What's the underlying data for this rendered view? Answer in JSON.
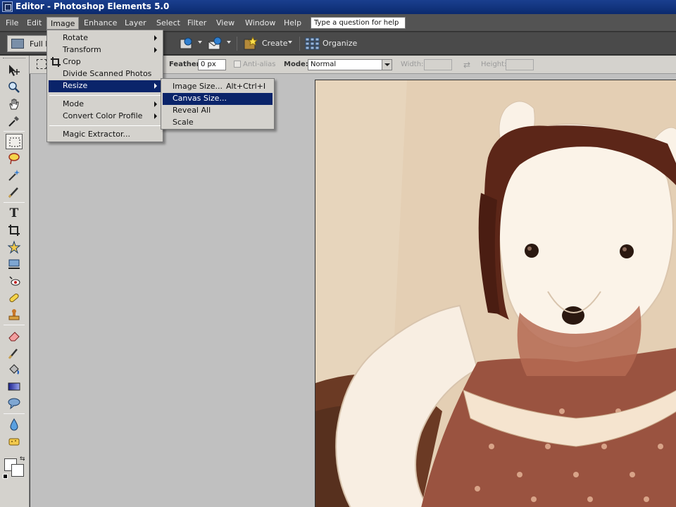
{
  "window": {
    "title": "Editor - Photoshop Elements 5.0"
  },
  "menubar": {
    "items": [
      "File",
      "Edit",
      "Image",
      "Enhance",
      "Layer",
      "Select",
      "Filter",
      "View",
      "Window",
      "Help"
    ],
    "active": "Image",
    "help_placeholder": "Type a question for help"
  },
  "shortcuts": {
    "full_edit_label": "Full E",
    "create_label": "Create",
    "organize_label": "Organize"
  },
  "options": {
    "feather_label": "Feather:",
    "feather_value": "0 px",
    "antialias_label": "Anti-alias",
    "antialias_checked": false,
    "mode_label": "Mode:",
    "mode_value": "Normal",
    "width_label": "Width:",
    "width_value": "",
    "height_label": "Height:",
    "height_value": ""
  },
  "image_menu": {
    "items": [
      {
        "label": "Rotate",
        "submenu": true
      },
      {
        "label": "Transform",
        "submenu": true
      },
      {
        "label": "Crop",
        "icon": "crop-icon"
      },
      {
        "label": "Divide Scanned Photos"
      },
      {
        "label": "Resize",
        "submenu": true,
        "highlighted": true
      },
      {
        "label": "Mode",
        "submenu": true
      },
      {
        "label": "Convert Color Profile",
        "submenu": true
      },
      {
        "label": "Magic Extractor..."
      }
    ]
  },
  "resize_submenu": {
    "items": [
      {
        "label": "Image Size...",
        "shortcut": "Alt+Ctrl+I"
      },
      {
        "label": "Canvas Size...",
        "highlighted": true
      },
      {
        "label": "Reveal All"
      },
      {
        "label": "Scale"
      }
    ]
  },
  "toolbox": {
    "tools": [
      "move-tool",
      "zoom-tool",
      "hand-tool",
      "eyedropper-tool",
      "rectangular-marquee-tool",
      "lasso-tool",
      "magic-wand-tool",
      "selection-brush-tool",
      "type-tool",
      "crop-tool",
      "cookie-cutter-tool",
      "straighten-tool",
      "red-eye-removal-tool",
      "spot-healing-brush-tool",
      "clone-stamp-tool",
      "eraser-tool",
      "pencil-tool",
      "paint-bucket-tool",
      "gradient-tool",
      "custom-shape-tool",
      "blur-tool",
      "sponge-tool"
    ],
    "selected": "rectangular-marquee-tool",
    "foreground_color": "#ffffff",
    "background_color": "#ffffff"
  },
  "colors": {
    "titlebar": "#0b2a6e",
    "menu_highlight": "#0a246a",
    "workspace": "#c0c0c0"
  }
}
